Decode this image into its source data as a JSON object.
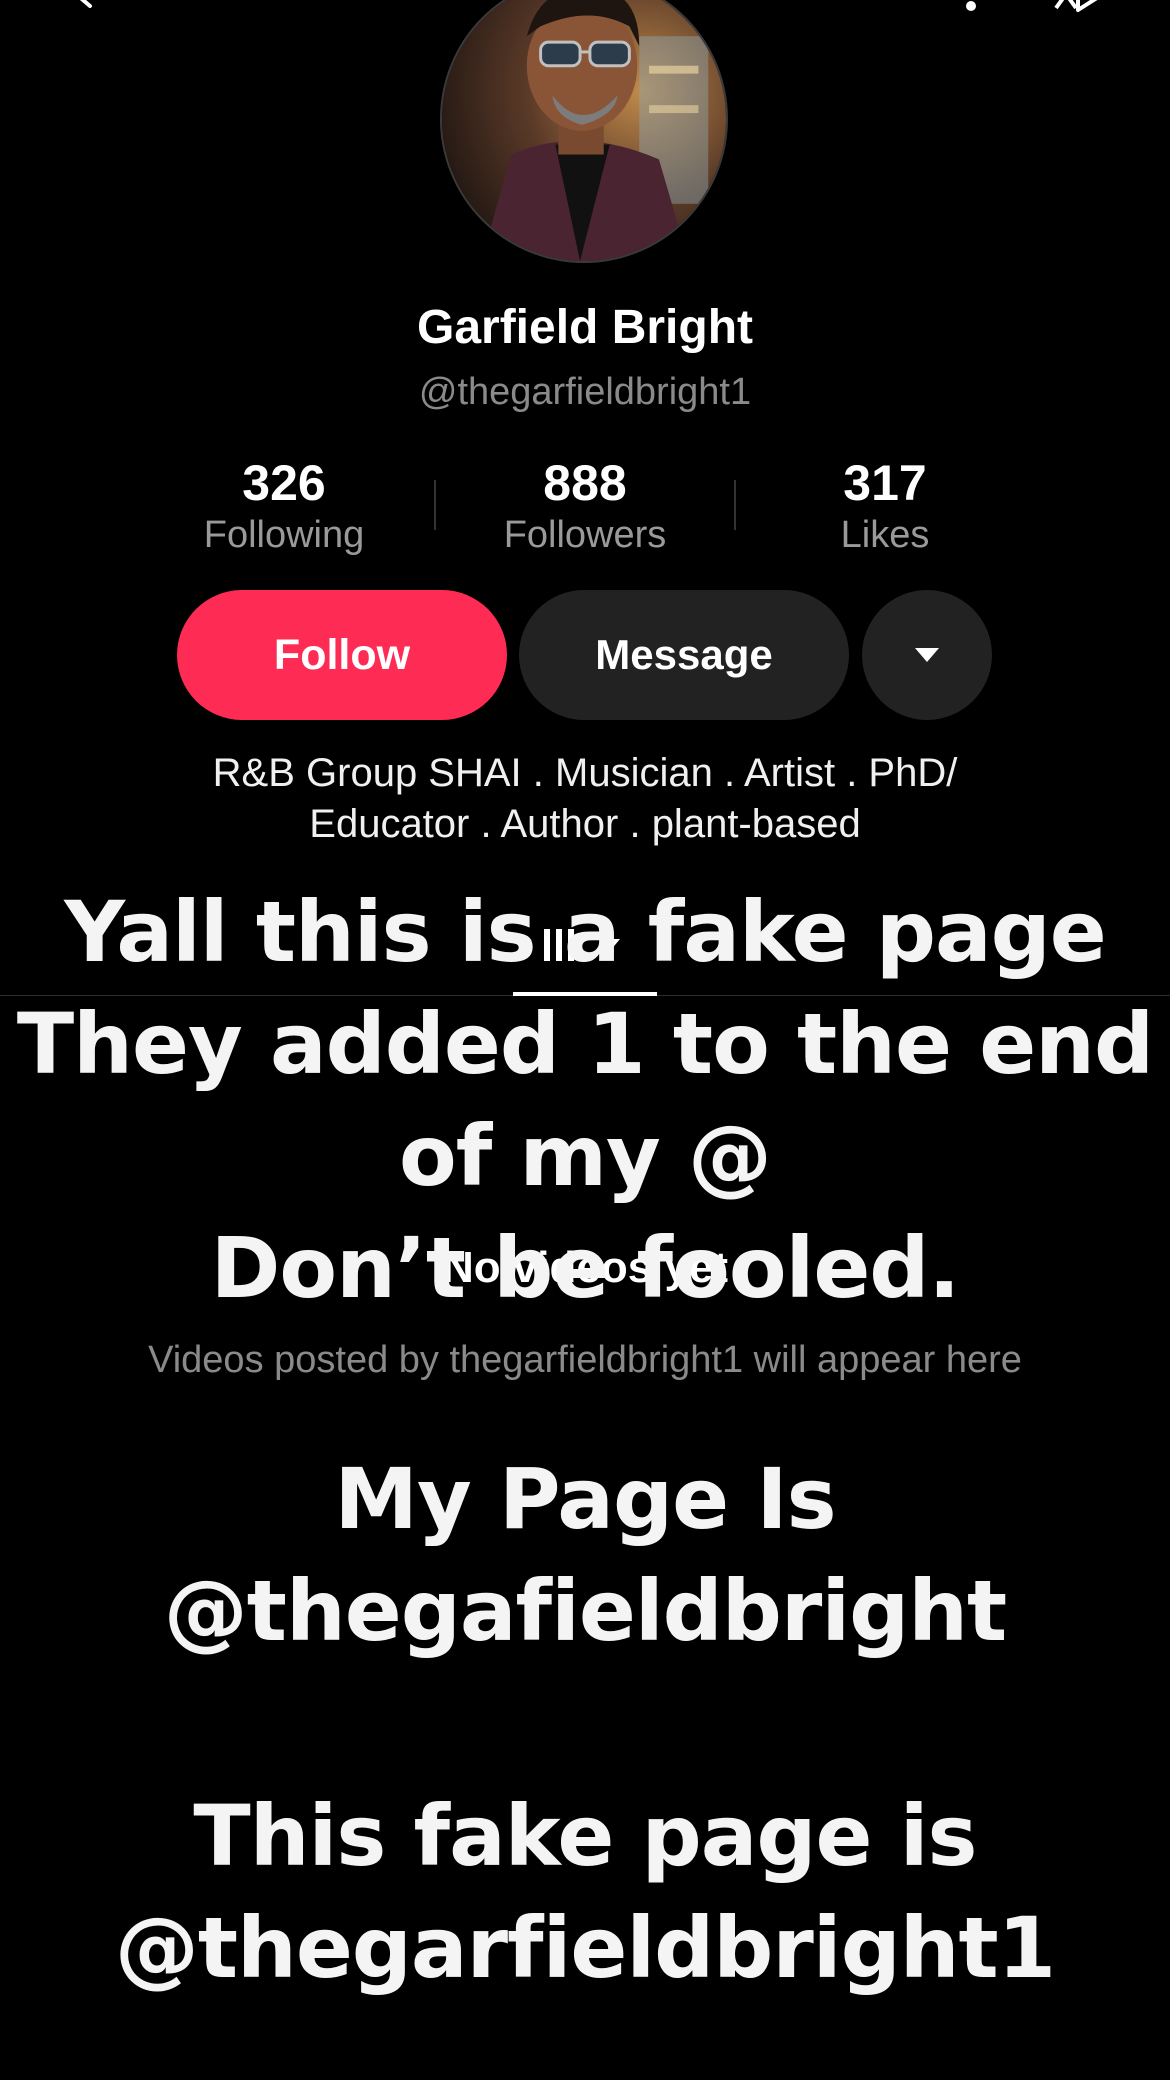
{
  "profile": {
    "display_name": "Garfield Bright",
    "handle": "@thegarfieldbright1",
    "bio_line1": "R&B Group SHAI . Musician . Artist . PhD/",
    "bio_line2": "Educator . Author . plant-based"
  },
  "stats": {
    "following": {
      "value": "326",
      "label": "Following"
    },
    "followers": {
      "value": "888",
      "label": "Followers"
    },
    "likes": {
      "value": "317",
      "label": "Likes"
    }
  },
  "actions": {
    "follow_label": "Follow",
    "message_label": "Message"
  },
  "empty_state": {
    "title": "No videos yet",
    "subtitle": "Videos posted by thegarfieldbright1 will appear here"
  },
  "overlay": {
    "line1": "Yall this is a fake page",
    "line2": "They added 1 to the end",
    "line3": "of my @",
    "line4": "Don’t be fooled.",
    "line5": "My Page Is",
    "line6": "@thegafieldbright",
    "line7": "This fake page is",
    "line8": "@thegarfieldbright1"
  },
  "colors": {
    "follow": "#fe2c55",
    "background": "#000000",
    "secondary_button": "#222222"
  },
  "icons": [
    "back-icon",
    "bell-icon",
    "share-icon",
    "chevron-down-icon",
    "videos-grid-icon"
  ]
}
